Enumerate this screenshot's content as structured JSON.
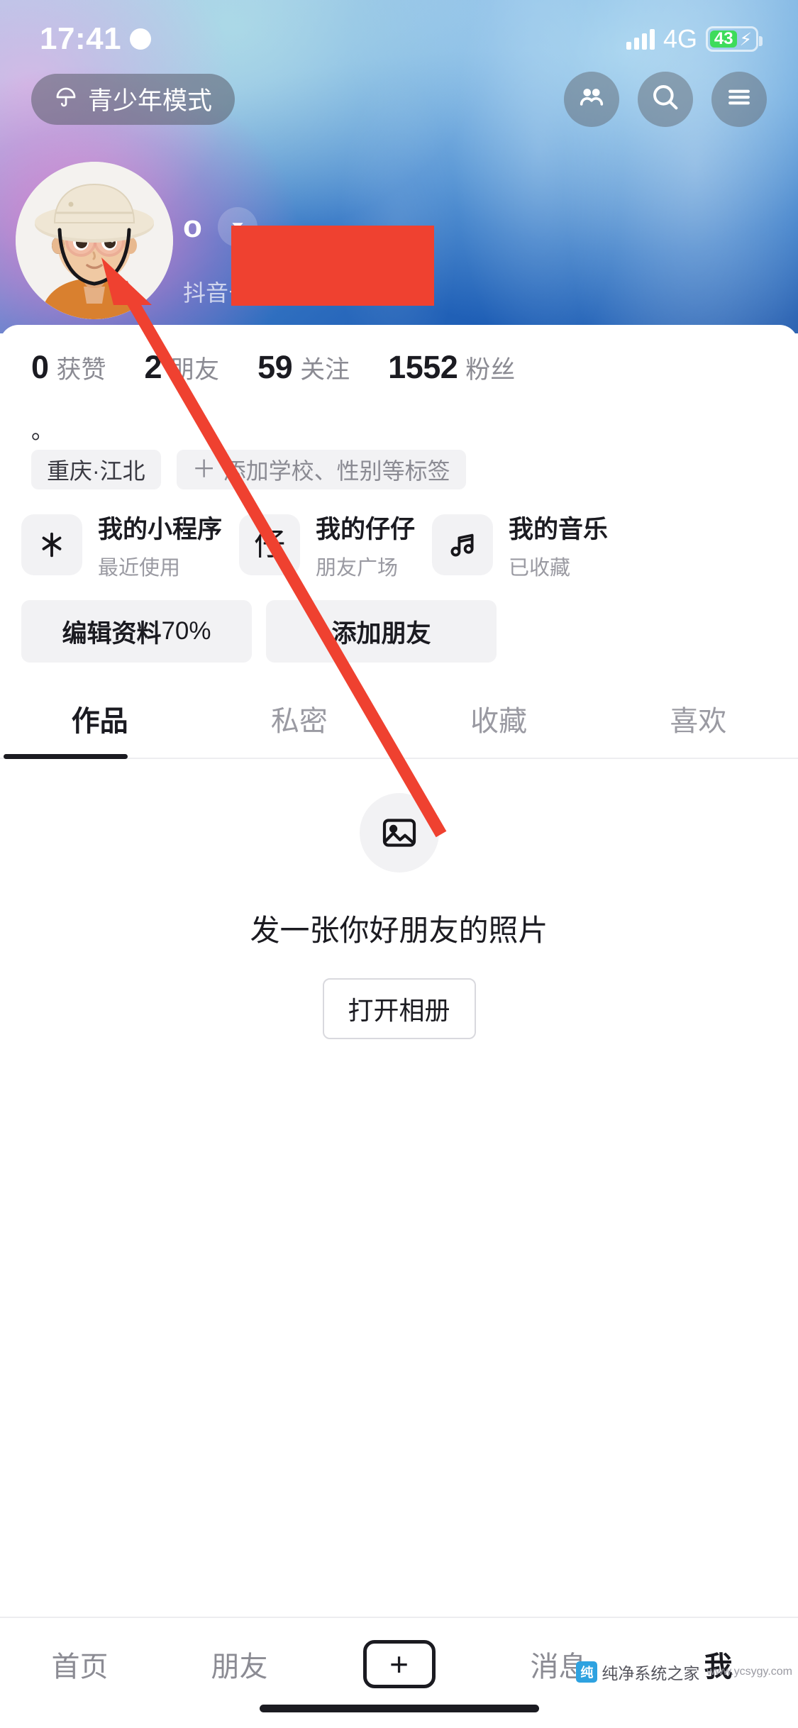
{
  "status_bar": {
    "time": "17:41",
    "moon_icon": "crescent-moon-icon",
    "network": "4G",
    "battery_percent": "43",
    "battery_charging": true
  },
  "header": {
    "teen_mode": {
      "label": "青少年模式",
      "icon": "umbrella-icon"
    },
    "icons": [
      {
        "name": "friends-icon",
        "label": "朋友"
      },
      {
        "name": "search-icon",
        "label": "搜索"
      },
      {
        "name": "menu-icon",
        "label": "菜单"
      }
    ]
  },
  "profile": {
    "avatar_alt": "卡通头像",
    "username": "o",
    "caret_icon": "chevron-down-icon",
    "douyin_id_label": "抖音号",
    "douyin_id_value": "",
    "redacted": true,
    "bio": "。",
    "stats": [
      {
        "value": "0",
        "label": "获赞"
      },
      {
        "value": "2",
        "label": "朋友"
      },
      {
        "value": "59",
        "label": "关注"
      },
      {
        "value": "1552",
        "label": "粉丝"
      }
    ],
    "tags": [
      {
        "text": "重庆·江北",
        "muted": false,
        "has_plus": false
      },
      {
        "text": "添加学校、性别等标签",
        "muted": true,
        "has_plus": true
      }
    ]
  },
  "entry_cards": [
    {
      "icon": "douyin-logo-icon",
      "title": "我的小程序",
      "subtitle": "最近使用"
    },
    {
      "icon": "zaizai-icon",
      "title": "我的仔仔",
      "subtitle": "朋友广场"
    },
    {
      "icon": "music-note-icon",
      "title": "我的音乐",
      "subtitle": "已收藏"
    }
  ],
  "actions": [
    {
      "label": "编辑资料",
      "suffix": "70%"
    },
    {
      "label": "添加朋友",
      "suffix": ""
    }
  ],
  "tabs": [
    {
      "label": "作品",
      "active": true
    },
    {
      "label": "私密",
      "active": false
    },
    {
      "label": "收藏",
      "active": false
    },
    {
      "label": "喜欢",
      "active": false
    }
  ],
  "empty_state": {
    "icon": "photo-icon",
    "message": "发一张你好朋友的照片",
    "button_label": "打开相册"
  },
  "bottom_nav": [
    {
      "label": "首页",
      "active": false
    },
    {
      "label": "朋友",
      "active": false
    },
    {
      "label": "+",
      "active": false,
      "is_plus": true
    },
    {
      "label": "消息",
      "active": false
    },
    {
      "label": "我",
      "active": true
    }
  ],
  "watermark": {
    "badge": "纯",
    "text": "纯净系统之家",
    "sub": "www.ycsygy.com"
  },
  "colors": {
    "accent_red": "#ef4130",
    "battery_green": "#3ddc5b",
    "text_primary": "#1b1b21",
    "text_muted": "#8b8b93",
    "chip_bg": "#f2f2f4"
  }
}
